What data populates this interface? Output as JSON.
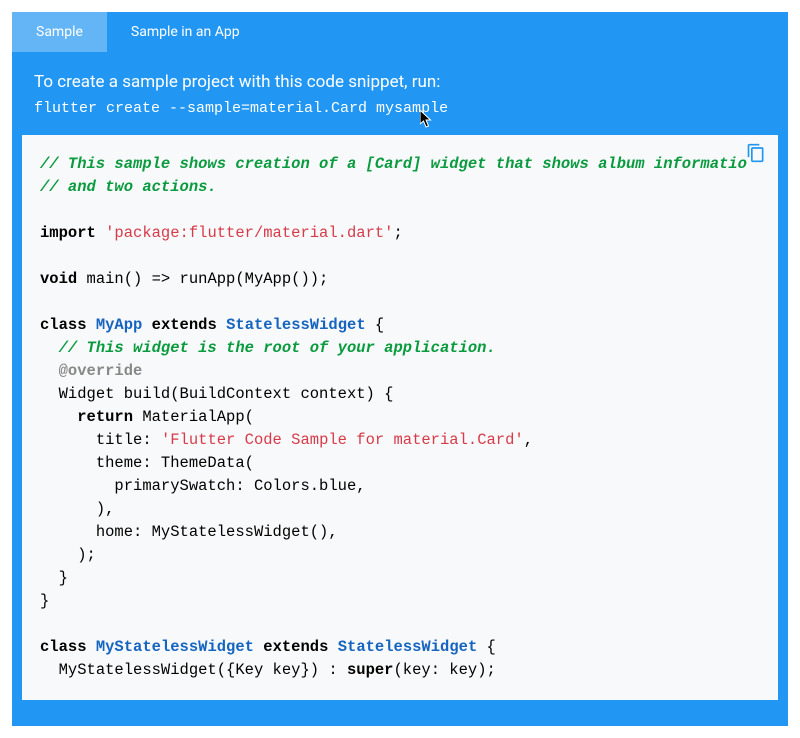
{
  "tabs": {
    "sample": "Sample",
    "sample_in_app": "Sample in an App"
  },
  "description": "To create a sample project with this code snippet, run:",
  "command": "flutter create --sample=material.Card mysample",
  "code": {
    "c1": "// This sample shows creation of a [Card] widget that shows album informatio",
    "c2": "// and two actions.",
    "kw_import": "import",
    "str_pkg": "'package:flutter/material.dart'",
    "semi": ";",
    "kw_void": "void",
    "main_sig": " main() => runApp(MyApp());",
    "kw_class": "class",
    "ty_myapp": "MyApp",
    "kw_extends": "extends",
    "ty_sw": "StatelessWidget",
    "brace_open": " {",
    "c3": "// This widget is the root of your application.",
    "annot_override": "@override",
    "build_sig": "Widget build(BuildContext context) {",
    "kw_return": "return",
    "matapp": " MaterialApp(",
    "title_lbl": "title: ",
    "str_title": "'Flutter Code Sample for material.Card'",
    "comma": ",",
    "theme": "theme: ThemeData(",
    "primary": "primarySwatch: Colors.blue,",
    "home": "home: MyStatelessWidget(),",
    "close_paren_semi": ");",
    "close_paren_comma": "),",
    "brace_close": "}",
    "ty_msw": "MyStatelessWidget",
    "ctor_pre": "MyStatelessWidget({Key key}) : ",
    "kw_super": "super",
    "ctor_post": "(key: key);"
  }
}
